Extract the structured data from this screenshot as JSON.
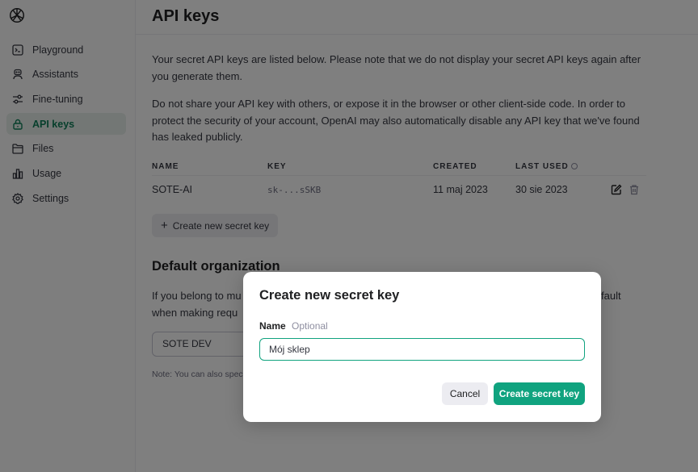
{
  "sidebar": {
    "items": [
      {
        "label": "Playground",
        "icon": "terminal-icon"
      },
      {
        "label": "Assistants",
        "icon": "robot-icon"
      },
      {
        "label": "Fine-tuning",
        "icon": "sliders-icon"
      },
      {
        "label": "API keys",
        "icon": "lock-icon",
        "active": true
      },
      {
        "label": "Files",
        "icon": "folder-icon"
      },
      {
        "label": "Usage",
        "icon": "bar-chart-icon"
      },
      {
        "label": "Settings",
        "icon": "gear-icon"
      }
    ]
  },
  "header": {
    "title": "API keys"
  },
  "main": {
    "intro_1": "Your secret API keys are listed below. Please note that we do not display your secret API keys again after you generate them.",
    "intro_2": "Do not share your API key with others, or expose it in the browser or other client-side code. In order to protect the security of your account, OpenAI may also automatically disable any API key that we've found has leaked publicly.",
    "table": {
      "columns": [
        "NAME",
        "KEY",
        "CREATED",
        "LAST USED"
      ],
      "rows": [
        {
          "name": "SOTE-AI",
          "key": "sk-...sSKB",
          "created": "11 maj 2023",
          "last_used": "30 sie 2023"
        }
      ]
    },
    "create_new_label": "Create new secret key",
    "org": {
      "title": "Default organization",
      "description": "If you belong to mu ... fault when making requ ...",
      "desc_line1_left": "If you belong to mu",
      "desc_line1_right": "fault",
      "desc_line2_left": "when making requ",
      "selected_org": "SOTE DEV",
      "note": "Note: You can also spec"
    }
  },
  "modal": {
    "title": "Create new secret key",
    "field_label": "Name",
    "field_hint": "Optional",
    "field_value": "Mój sklep",
    "cancel_label": "Cancel",
    "submit_label": "Create secret key"
  },
  "colors": {
    "accent": "#10a37f",
    "active_nav_text": "#0f7f59",
    "overlay": "rgba(0,0,0,0.5)"
  }
}
